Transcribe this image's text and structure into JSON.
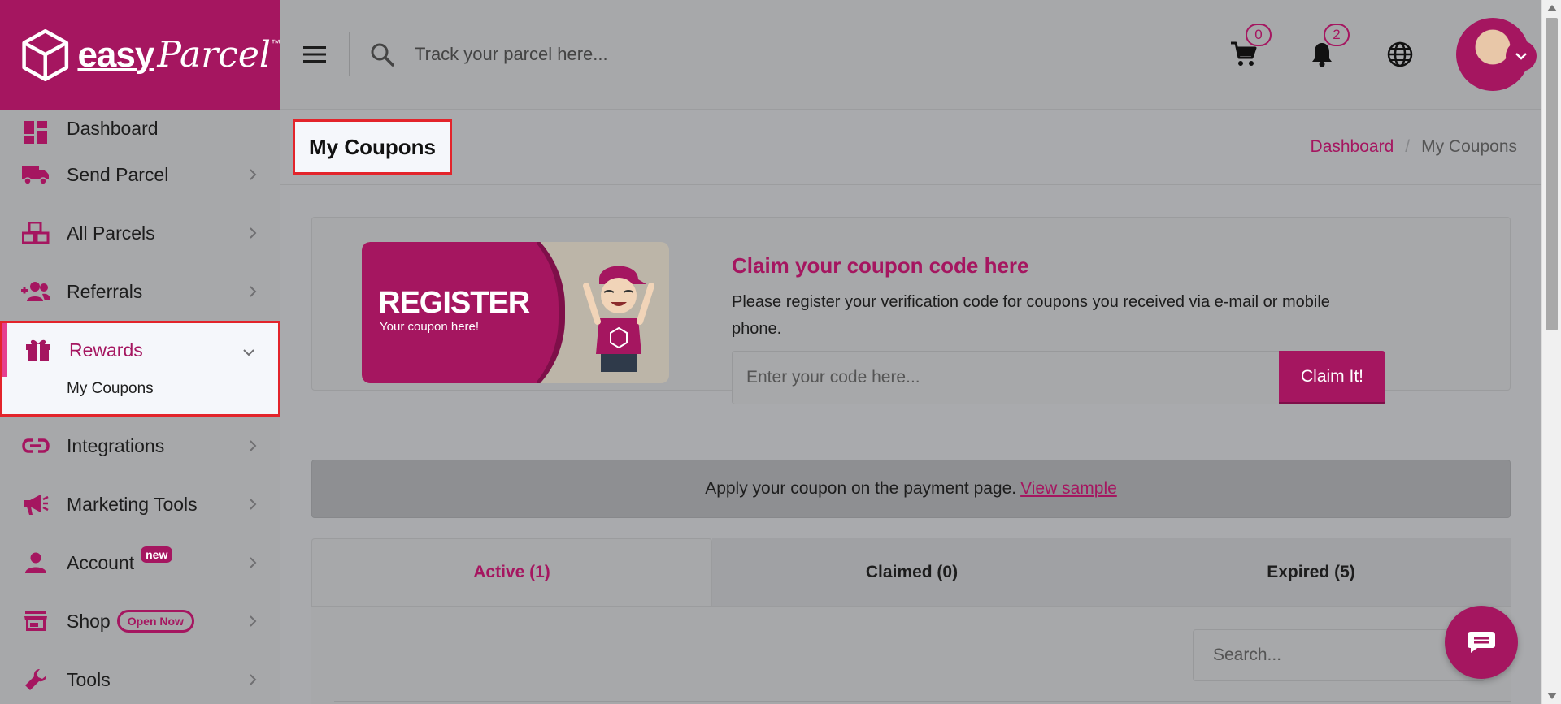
{
  "brand": {
    "logo_easy": "easy",
    "logo_parcel": "Parcel",
    "logo_tm": "™",
    "primary_color": "#a51660",
    "accent_color": "#e63e8f"
  },
  "topbar": {
    "search_placeholder": "Track your parcel here...",
    "cart_count": "0",
    "notification_count": "2"
  },
  "sidebar": {
    "items": [
      {
        "label": "Dashboard",
        "icon": "dashboard-icon"
      },
      {
        "label": "Send Parcel",
        "icon": "truck-icon"
      },
      {
        "label": "All Parcels",
        "icon": "boxes-icon"
      },
      {
        "label": "Referrals",
        "icon": "users-plus-icon"
      },
      {
        "label": "Rewards",
        "icon": "gift-icon"
      },
      {
        "label": "Integrations",
        "icon": "link-icon"
      },
      {
        "label": "Marketing Tools",
        "icon": "megaphone-icon"
      },
      {
        "label": "Account",
        "icon": "person-icon",
        "badge": "new"
      },
      {
        "label": "Shop",
        "icon": "store-icon",
        "badge": "Open Now"
      },
      {
        "label": "Tools",
        "icon": "wrench-icon"
      }
    ],
    "rewards_sub": "My Coupons"
  },
  "page": {
    "title": "My Coupons",
    "breadcrumb": {
      "home": "Dashboard",
      "separator": "/",
      "current": "My Coupons"
    }
  },
  "claim": {
    "banner_title": "REGISTER",
    "banner_sub": "Your coupon here!",
    "title": "Claim your coupon code here",
    "description": "Please register your verification code for coupons you received via e-mail or mobile phone.",
    "code_placeholder": "Enter your code here...",
    "button": "Claim It!"
  },
  "notice": {
    "text": "Apply your coupon on the payment page.",
    "link": "View sample"
  },
  "tabs": [
    {
      "label": "Active (1)",
      "active": true
    },
    {
      "label": "Claimed (0)",
      "active": false
    },
    {
      "label": "Expired (5)",
      "active": false
    }
  ],
  "table": {
    "search_placeholder": "Search..."
  }
}
